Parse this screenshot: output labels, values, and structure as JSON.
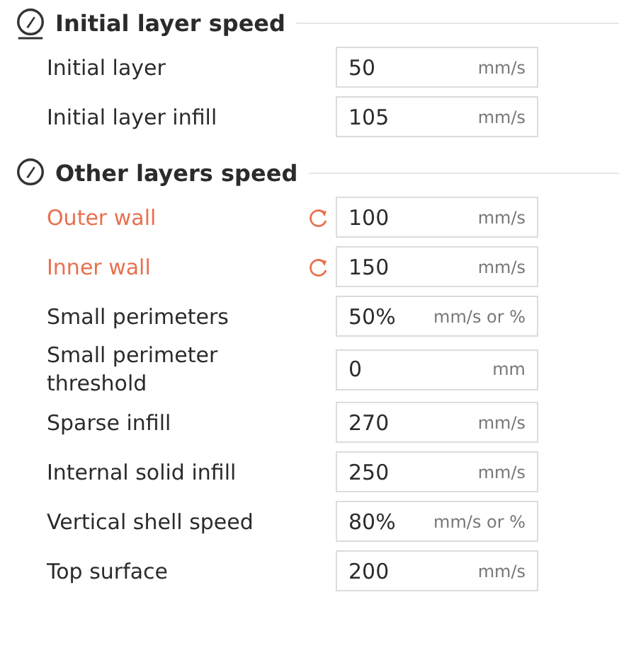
{
  "sections": [
    {
      "title": "Initial layer speed",
      "rows": [
        {
          "label": "Initial layer",
          "modified": false,
          "value": "50",
          "unit": "mm/s"
        },
        {
          "label": "Initial layer infill",
          "modified": false,
          "value": "105",
          "unit": "mm/s"
        }
      ]
    },
    {
      "title": "Other layers speed",
      "rows": [
        {
          "label": "Outer wall",
          "modified": true,
          "value": "100",
          "unit": "mm/s"
        },
        {
          "label": "Inner wall",
          "modified": true,
          "value": "150",
          "unit": "mm/s"
        },
        {
          "label": "Small perimeters",
          "modified": false,
          "value": "50%",
          "unit": "mm/s or %"
        },
        {
          "label": "Small perimeter threshold",
          "modified": false,
          "value": "0",
          "unit": "mm"
        },
        {
          "label": "Sparse infill",
          "modified": false,
          "value": "270",
          "unit": "mm/s"
        },
        {
          "label": "Internal solid infill",
          "modified": false,
          "value": "250",
          "unit": "mm/s"
        },
        {
          "label": "Vertical shell speed",
          "modified": false,
          "value": "80%",
          "unit": "mm/s or %"
        },
        {
          "label": "Top surface",
          "modified": false,
          "value": "200",
          "unit": "mm/s"
        }
      ]
    }
  ]
}
